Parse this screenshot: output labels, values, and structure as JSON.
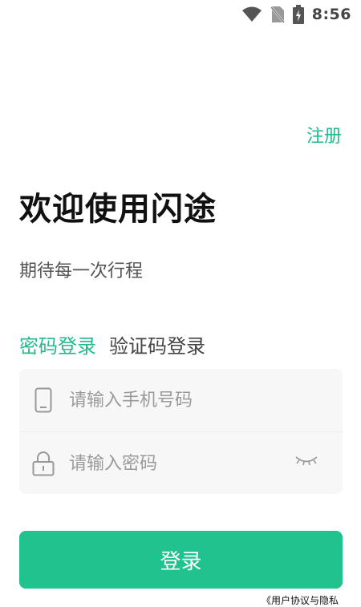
{
  "status_bar": {
    "time": "8:56",
    "icons": [
      "wifi-icon",
      "no-sim-icon",
      "battery-charging-icon"
    ]
  },
  "header": {
    "register_label": "注册"
  },
  "welcome": {
    "title": "欢迎使用闪途",
    "subtitle": "期待每一次行程"
  },
  "tabs": [
    {
      "label": "密码登录",
      "active": true
    },
    {
      "label": "验证码登录",
      "active": false
    }
  ],
  "form": {
    "phone": {
      "placeholder": "请输入手机号码",
      "value": "",
      "icon": "phone-icon"
    },
    "password": {
      "placeholder": "请输入密码",
      "value": "",
      "icon": "lock-icon",
      "toggle_icon": "eye-closed-icon"
    }
  },
  "login_button_label": "登录",
  "agreement_text": "《用户协议与隐私",
  "colors": {
    "accent": "#23b98a",
    "button": "#21c28d",
    "field_background": "#f7f7f7"
  }
}
